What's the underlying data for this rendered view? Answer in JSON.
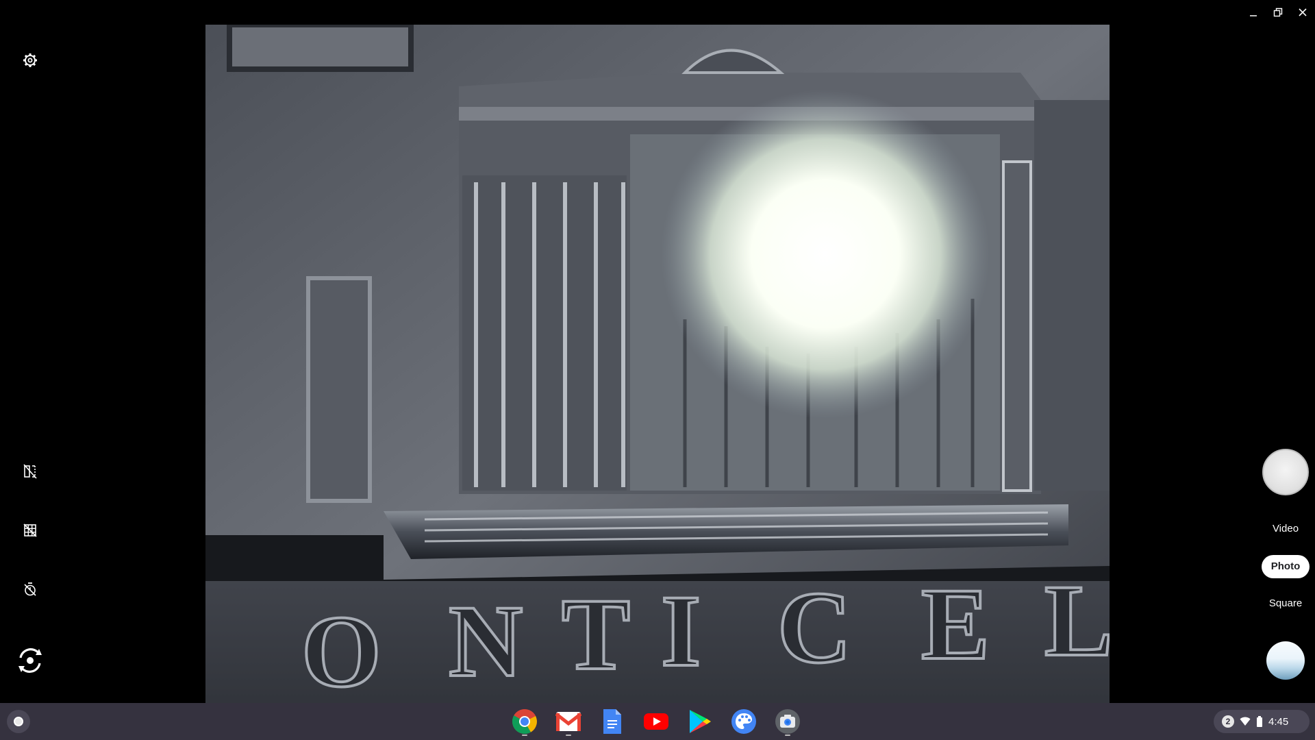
{
  "window_controls": [
    "minimize-icon",
    "restore-icon",
    "close-icon"
  ],
  "left_rail": [
    "settings-icon",
    "mirror-icon",
    "grid-icon",
    "timer-off-icon",
    "switch-camera-icon"
  ],
  "preview": {
    "inscription_letters": [
      "O",
      "N",
      "T",
      "I",
      "C",
      "E",
      "L"
    ]
  },
  "right_rail": {
    "modes": {
      "video": "Video",
      "photo": "Photo",
      "square": "Square"
    },
    "selected_mode": "Photo"
  },
  "shelf": {
    "apps": [
      "chrome",
      "gmail",
      "docs",
      "youtube",
      "play-store",
      "canvas",
      "camera"
    ],
    "notification_count": "2",
    "time": "4:45",
    "colors": {
      "shelf_bg": "#35323f",
      "accent": "#4285f4"
    }
  }
}
